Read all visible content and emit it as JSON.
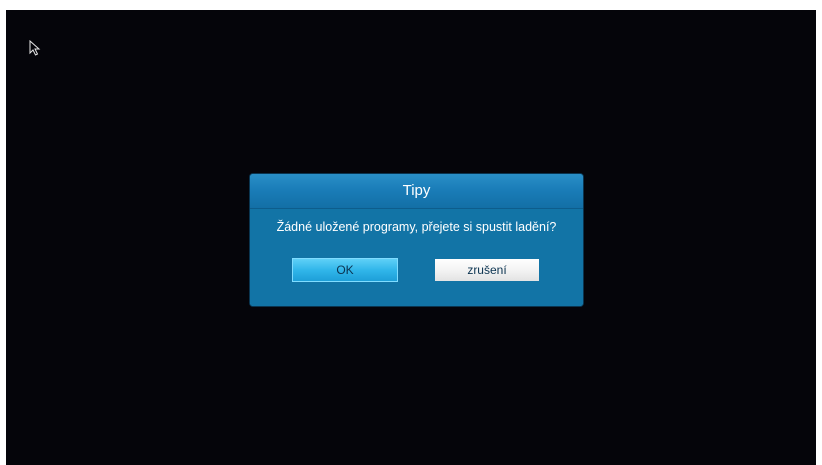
{
  "dialog": {
    "title": "Tipy",
    "message": "Žádné uložené programy, přejete si spustit ladění?",
    "ok_label": "OK",
    "cancel_label": "zrušení"
  },
  "colors": {
    "screen_background": "#05050a",
    "dialog_background": "#1274a6",
    "ok_button": "#31b6ea",
    "cancel_button": "#f2f2f2"
  },
  "icons": {
    "cursor": "mouse-pointer-icon"
  }
}
